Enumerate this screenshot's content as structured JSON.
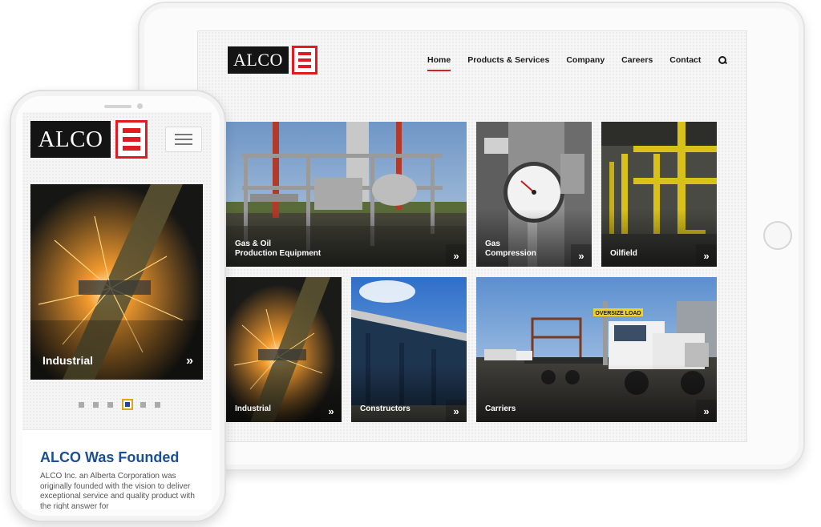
{
  "brand": {
    "logo_text": "ALCO",
    "accent_color": "#e01b22",
    "title_color": "#1b4f94"
  },
  "tablet": {
    "nav": {
      "items": [
        {
          "label": "Home",
          "active": true
        },
        {
          "label": "Products & Services",
          "active": false
        },
        {
          "label": "Company",
          "active": false
        },
        {
          "label": "Careers",
          "active": false
        },
        {
          "label": "Contact",
          "active": false
        }
      ],
      "search_icon": "search-icon"
    },
    "tiles": [
      {
        "label": "Gas & Oil\nProduction Equipment",
        "chevron": "»"
      },
      {
        "label": "Gas\nCompression",
        "chevron": "»"
      },
      {
        "label": "Oilfield",
        "chevron": "»"
      },
      {
        "label": "Industrial",
        "chevron": "»"
      },
      {
        "label": "Constructors",
        "chevron": "»"
      },
      {
        "label": "Carriers",
        "chevron": "»"
      }
    ],
    "truck_sign": "OVERSIZE LOAD"
  },
  "phone": {
    "menu_icon": "hamburger-menu-icon",
    "hero": {
      "label": "Industrial",
      "chevron": "»"
    },
    "carousel": {
      "count": 6,
      "active_index": 3
    },
    "card": {
      "title": "ALCO Was Founded",
      "text": "ALCO Inc. an Alberta Corporation was originally founded with the vision to deliver exceptional service and quality product with the right answer for"
    }
  }
}
